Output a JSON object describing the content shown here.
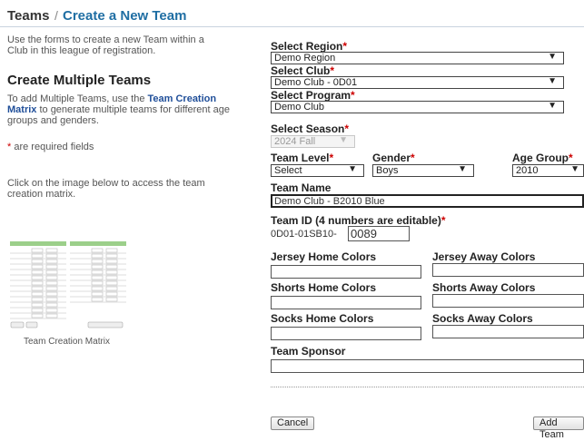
{
  "breadcrumb": {
    "section": "Teams",
    "separator": "/",
    "page": "Create a New Team"
  },
  "intro": "Use the forms to create a new Team within a Club in this league of registration.",
  "multi": {
    "heading": "Create Multiple Teams",
    "text_before": "To add Multiple Teams, use the ",
    "link": "Team Creation Matrix",
    "text_after": " to generate multiple teams for different age groups and genders."
  },
  "required_note": {
    "star": "*",
    "text": " are required fields"
  },
  "image_hint": "Click on the image below to access the team creation matrix.",
  "matrix_caption": "Team Creation Matrix",
  "form": {
    "region": {
      "label": "Select Region",
      "value": "Demo Region"
    },
    "club": {
      "label": "Select Club",
      "value": "Demo Club - 0D01"
    },
    "program": {
      "label": "Select Program",
      "value": "Demo Club"
    },
    "season": {
      "label": "Select Season",
      "value": "2024 Fall"
    },
    "team_level": {
      "label": "Team Level",
      "value": "Select"
    },
    "gender": {
      "label": "Gender",
      "value": "Boys"
    },
    "age_group": {
      "label": "Age Group",
      "value": "2010"
    },
    "team_name": {
      "label": "Team Name",
      "value": "Demo Club - B2010 Blue"
    },
    "team_id": {
      "label": "Team ID (4 numbers are editable)",
      "prefix": "0D01-01SB10-",
      "value": "0089"
    },
    "jersey_home": {
      "label": "Jersey Home Colors",
      "value": ""
    },
    "jersey_away": {
      "label": "Jersey Away Colors",
      "value": ""
    },
    "shorts_home": {
      "label": "Shorts Home Colors",
      "value": ""
    },
    "shorts_away": {
      "label": "Shorts Away Colors",
      "value": ""
    },
    "socks_home": {
      "label": "Socks Home Colors",
      "value": ""
    },
    "socks_away": {
      "label": "Socks Away Colors",
      "value": ""
    },
    "sponsor": {
      "label": "Team Sponsor",
      "value": ""
    },
    "required_star": "*"
  },
  "buttons": {
    "cancel": "Cancel",
    "add": "Add Team"
  },
  "colors": {
    "title_link": "#1f6ea3",
    "required": "#cc0000",
    "matrix_header": "#9ccf8a"
  },
  "icons": {
    "dropdown": "chevron-down-icon"
  }
}
